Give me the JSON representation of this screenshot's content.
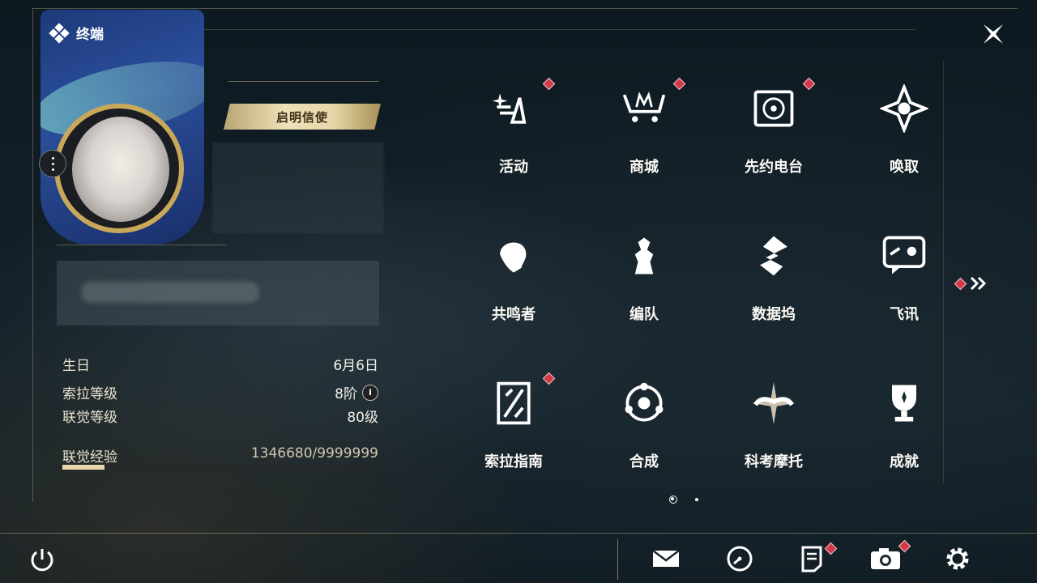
{
  "header": {
    "title": "终端"
  },
  "profile": {
    "title_badge": "启明信使",
    "stats": [
      {
        "label": "生日",
        "value": "6月6日"
      },
      {
        "label": "索拉等级",
        "value": "8阶"
      },
      {
        "label": "联觉等级",
        "value": "80级"
      }
    ],
    "exp": {
      "label": "联觉经验",
      "value": "1346680/9999999",
      "progress": 0.1347
    }
  },
  "menu": [
    {
      "label": "活动",
      "icon": "sparkle-activity-icon",
      "badge": true
    },
    {
      "label": "商城",
      "icon": "crown-cart-icon",
      "badge": true
    },
    {
      "label": "先约电台",
      "icon": "radio-icon",
      "badge": true
    },
    {
      "label": "唤取",
      "icon": "compass-star-icon",
      "badge": false
    },
    {
      "label": "共鸣者",
      "icon": "character-head-icon",
      "badge": false
    },
    {
      "label": "编队",
      "icon": "chess-pieces-icon",
      "badge": false
    },
    {
      "label": "数据坞",
      "icon": "data-dock-icon",
      "badge": false
    },
    {
      "label": "飞讯",
      "icon": "chat-bubble-icon",
      "badge": false
    },
    {
      "label": "索拉指南",
      "icon": "guide-book-icon",
      "badge": true
    },
    {
      "label": "合成",
      "icon": "synthesis-orbit-icon",
      "badge": false
    },
    {
      "label": "科考摩托",
      "icon": "motorbike-icon",
      "badge": false
    },
    {
      "label": "成就",
      "icon": "trophy-icon",
      "badge": false
    }
  ],
  "pager": {
    "pages": 2,
    "current": 1
  },
  "bottom": [
    {
      "name": "mail-icon",
      "badge": false
    },
    {
      "name": "clock-icon",
      "badge": false
    },
    {
      "name": "notice-icon",
      "badge": true
    },
    {
      "name": "camera-icon",
      "badge": true
    },
    {
      "name": "settings-icon",
      "badge": false
    }
  ],
  "colors": {
    "accent": "#c9a85a",
    "badge": "#d23a4a",
    "text": "#fbf9f4"
  }
}
